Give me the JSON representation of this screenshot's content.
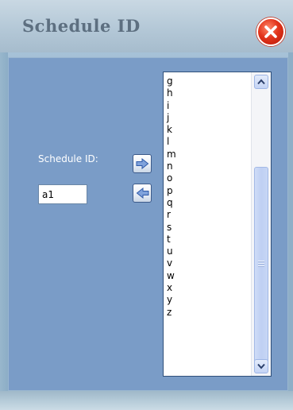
{
  "window": {
    "title": "Schedule ID"
  },
  "form": {
    "label": "Schedule ID:",
    "input_value": "a1"
  },
  "list": {
    "items": [
      "g",
      "h",
      "i",
      "j",
      "k",
      "l",
      "m",
      "n",
      "o",
      "p",
      "q",
      "r",
      "s",
      "t",
      "u",
      "v",
      "w",
      "x",
      "y",
      "z"
    ]
  },
  "icons": {
    "close": "close-icon",
    "add": "arrow-right-icon",
    "remove": "arrow-left-icon",
    "scroll_up": "scroll-up-icon",
    "scroll_down": "scroll-down-icon"
  },
  "colors": {
    "panel": "#7a9cc7",
    "close": "#e2341b",
    "title": "#5d6f80"
  }
}
